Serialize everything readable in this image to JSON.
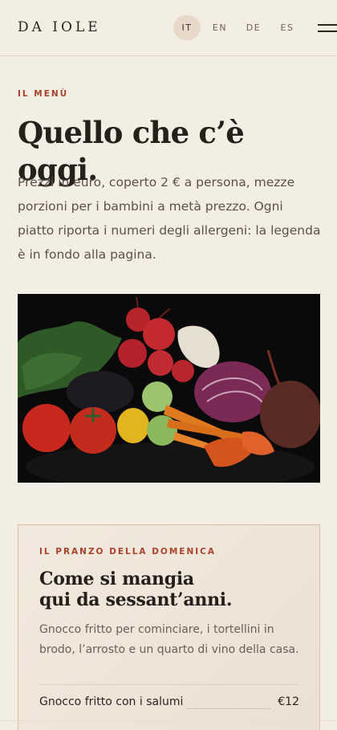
{
  "header": {
    "brand": "DA IOLE",
    "languages": [
      {
        "code": "IT",
        "active": true
      },
      {
        "code": "EN",
        "active": false
      },
      {
        "code": "DE",
        "active": false
      },
      {
        "code": "ES",
        "active": false
      }
    ],
    "menu_icon": "hamburger-icon"
  },
  "intro": {
    "eyebrow": "IL MENÙ",
    "title": "Quello che c’è oggi.",
    "text": "Prezzi in euro, coperto 2 € a persona, mezze porzioni per i bambini a metà prezzo. Ogni piatto riporta i numeri degli allergeni: la legenda è in fondo alla pagina."
  },
  "hero": {
    "image": "vegetables-photo"
  },
  "card": {
    "eyebrow": "IL PRANZO DELLA DOMENICA",
    "title_line1": "Come si mangia",
    "title_line2": "qui da sessant’anni.",
    "description": "Gnocco fritto per cominciare, i tortellini in brodo, l’arrosto e un quarto di vino della casa.",
    "items": [
      {
        "name": "Gnocco fritto con i salumi",
        "price": "€12"
      }
    ]
  },
  "colors": {
    "background": "#f3eee3",
    "accent": "#a8432e",
    "active_lang_bg": "#e8d8c9"
  }
}
